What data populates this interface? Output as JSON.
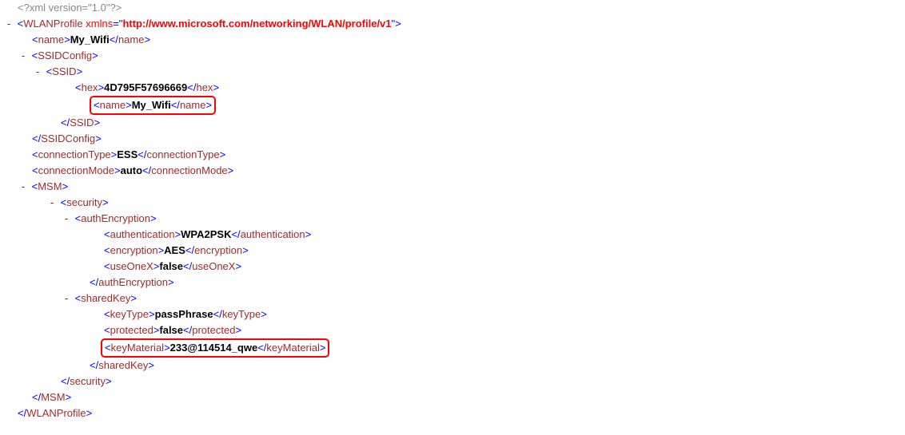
{
  "xmlDecl": "<?xml version=\"1.0\"?>",
  "root": {
    "tag": "WLANProfile",
    "xmlnsAttr": "xmlns",
    "xmlnsValue": "http://www.microsoft.com/networking/WLAN/profile/v1",
    "close": "WLANProfile"
  },
  "name": {
    "tag": "name",
    "value": "My_Wifi"
  },
  "ssidConfig": {
    "tag": "SSIDConfig"
  },
  "ssid": {
    "tag": "SSID"
  },
  "hex": {
    "tag": "hex",
    "value": "4D795F57696669"
  },
  "ssidName": {
    "tag": "name",
    "value": "My_Wifi"
  },
  "connType": {
    "tag": "connectionType",
    "value": "ESS"
  },
  "connMode": {
    "tag": "connectionMode",
    "value": "auto"
  },
  "msm": {
    "tag": "MSM"
  },
  "security": {
    "tag": "security"
  },
  "authEnc": {
    "tag": "authEncryption"
  },
  "auth": {
    "tag": "authentication",
    "value": "WPA2PSK"
  },
  "enc": {
    "tag": "encryption",
    "value": "AES"
  },
  "useOneX": {
    "tag": "useOneX",
    "value": "false"
  },
  "sharedKey": {
    "tag": "sharedKey"
  },
  "keyType": {
    "tag": "keyType",
    "value": "passPhrase"
  },
  "protected": {
    "tag": "protected",
    "value": "false"
  },
  "keyMaterial": {
    "tag": "keyMaterial",
    "value": "233@114514_qwe"
  }
}
